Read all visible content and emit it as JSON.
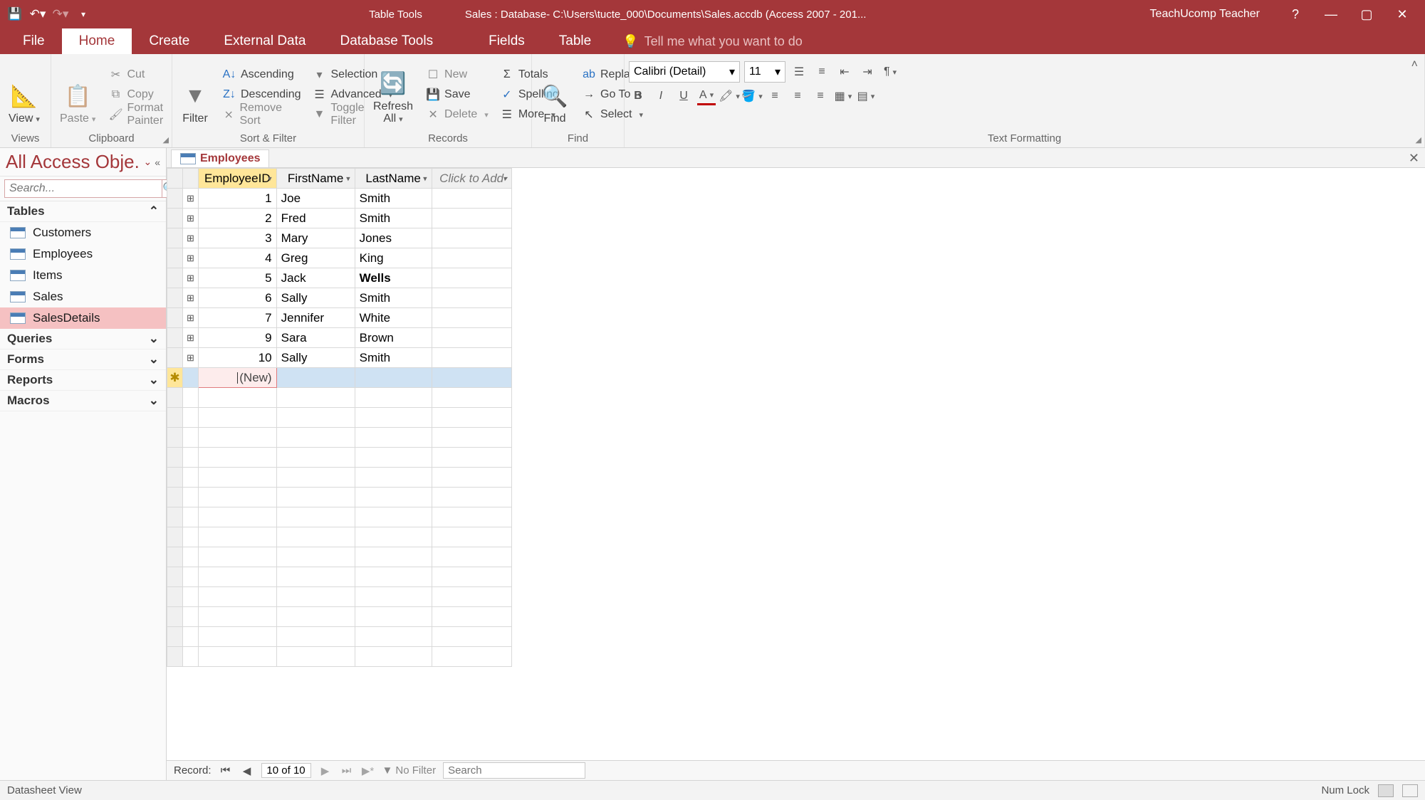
{
  "titleBar": {
    "toolTabGroup": "Table Tools",
    "title": "Sales : Database- C:\\Users\\tucte_000\\Documents\\Sales.accdb (Access 2007 - 201...",
    "user": "TeachUcomp Teacher"
  },
  "ribbonTabs": {
    "file": "File",
    "home": "Home",
    "create": "Create",
    "externalData": "External Data",
    "databaseTools": "Database Tools",
    "fields": "Fields",
    "table": "Table",
    "tellMe": "Tell me what you want to do"
  },
  "ribbon": {
    "views": {
      "view": "View",
      "group": "Views"
    },
    "clipboard": {
      "paste": "Paste",
      "cut": "Cut",
      "copy": "Copy",
      "formatPainter": "Format Painter",
      "group": "Clipboard"
    },
    "sortFilter": {
      "filter": "Filter",
      "asc": "Ascending",
      "desc": "Descending",
      "remove": "Remove Sort",
      "selection": "Selection",
      "advanced": "Advanced",
      "toggle": "Toggle Filter",
      "group": "Sort & Filter"
    },
    "records": {
      "refresh": "Refresh All",
      "new": "New",
      "save": "Save",
      "delete": "Delete",
      "totals": "Totals",
      "spelling": "Spelling",
      "more": "More",
      "group": "Records"
    },
    "find": {
      "find": "Find",
      "replace": "Replace",
      "goto": "Go To",
      "select": "Select",
      "group": "Find"
    },
    "textFormatting": {
      "font": "Calibri (Detail)",
      "size": "11",
      "group": "Text Formatting"
    }
  },
  "navPane": {
    "title": "All Access Obje...",
    "searchPlaceholder": "Search...",
    "groups": {
      "tables": "Tables",
      "queries": "Queries",
      "forms": "Forms",
      "reports": "Reports",
      "macros": "Macros"
    },
    "tables": [
      "Customers",
      "Employees",
      "Items",
      "Sales",
      "SalesDetails"
    ]
  },
  "docTab": "Employees",
  "columns": {
    "id": "EmployeeID",
    "first": "FirstName",
    "last": "LastName",
    "add": "Click to Add"
  },
  "rows": [
    {
      "id": "1",
      "first": "Joe",
      "last": "Smith"
    },
    {
      "id": "2",
      "first": "Fred",
      "last": "Smith"
    },
    {
      "id": "3",
      "first": "Mary",
      "last": "Jones"
    },
    {
      "id": "4",
      "first": "Greg",
      "last": "King"
    },
    {
      "id": "5",
      "first": "Jack",
      "last": "Wells",
      "boldLast": true
    },
    {
      "id": "6",
      "first": "Sally",
      "last": "Smith"
    },
    {
      "id": "7",
      "first": "Jennifer",
      "last": "White"
    },
    {
      "id": "9",
      "first": "Sara",
      "last": "Brown"
    },
    {
      "id": "10",
      "first": "Sally",
      "last": "Smith"
    }
  ],
  "newRowLabel": "(New)",
  "recordNav": {
    "label": "Record:",
    "pos": "10 of 10",
    "noFilter": "No Filter",
    "searchPlaceholder": "Search"
  },
  "statusBar": {
    "left": "Datasheet View",
    "numlock": "Num Lock"
  }
}
